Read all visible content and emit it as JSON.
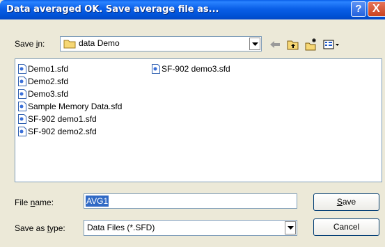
{
  "window": {
    "title": "Data averaged OK. Save average file as...",
    "help_glyph": "?",
    "close_glyph": "X"
  },
  "save_in": {
    "label_pre": "Save ",
    "label_accel": "i",
    "label_post": "n:",
    "value": "data Demo"
  },
  "toolbar": {
    "back_icon": "back-arrow-icon",
    "up_icon": "up-folder-icon",
    "new_icon": "new-folder-icon",
    "view_icon": "view-menu-icon"
  },
  "files": [
    "Demo1.sfd",
    "Demo2.sfd",
    "Demo3.sfd",
    "Sample Memory Data.sfd",
    "SF-902 demo1.sfd",
    "SF-902 demo2.sfd",
    "SF-902 demo3.sfd"
  ],
  "file_name": {
    "label_pre": "File ",
    "label_accel": "n",
    "label_post": "ame:",
    "value": "AVG1"
  },
  "save_type": {
    "label_pre": "Save as ",
    "label_accel": "t",
    "label_post": "ype:",
    "value": "Data Files (*.SFD)"
  },
  "buttons": {
    "save_accel": "S",
    "save_rest": "ave",
    "cancel": "Cancel"
  },
  "colors": {
    "titlebar": "#0a5fe8",
    "dialog_bg": "#ece9d8",
    "selection": "#316ac5"
  }
}
